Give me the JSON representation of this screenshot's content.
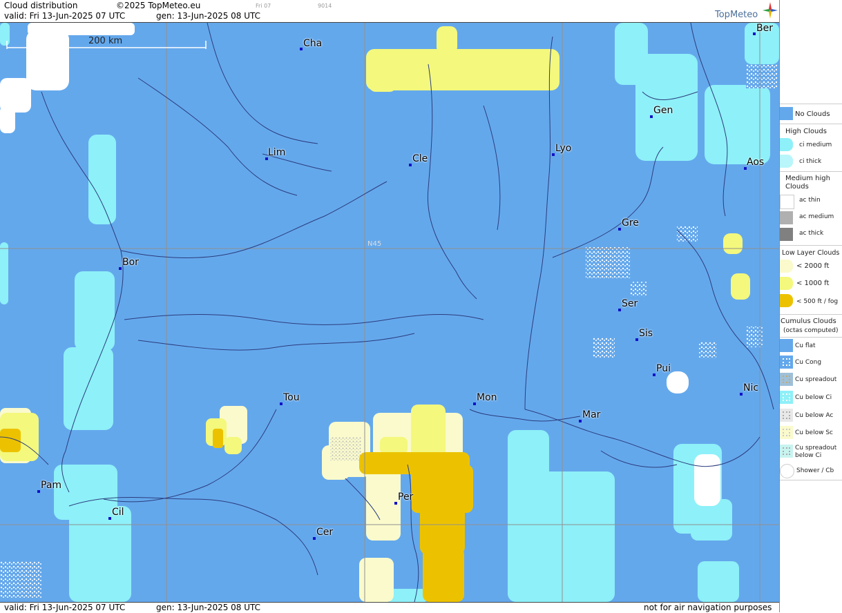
{
  "header": {
    "title": "Cloud distribution",
    "copyright": "©2025 TopMeteo.eu",
    "valid": "valid:  Fri  13-Jun-2025  07 UTC",
    "gen": "gen: 13-Jun-2025 08 UTC",
    "small_1": "Fri 07",
    "small_2": "9014",
    "brand": "TopMeteo"
  },
  "map": {
    "scale_label": "200 km",
    "lat_label": "N45",
    "cities": [
      "Ber",
      "Cha",
      "Gen",
      "Lim",
      "Cle",
      "Lyo",
      "Aos",
      "Gre",
      "Bor",
      "Ser",
      "Sis",
      "Pui",
      "Tou",
      "Mon",
      "Mar",
      "Nic",
      "Pam",
      "Cil",
      "Per",
      "Cer"
    ]
  },
  "footer": {
    "valid": "valid:  Fri  13-Jun-2025  07 UTC",
    "gen": "gen: 13-Jun-2025 08 UTC",
    "disclaimer": "not for air navigation purposes"
  },
  "legend": {
    "no_clouds": "No Clouds",
    "high_header": "High Clouds",
    "ci_medium": "ci medium",
    "ci_thick": "ci thick",
    "medium_header": "Medium high Clouds",
    "ac_thin": "ac thin",
    "ac_medium": "ac medium",
    "ac_thick": "ac thick",
    "low_header": "Low Layer Clouds",
    "low_2000": "< 2000 ft",
    "low_1000": "< 1000 ft",
    "low_500": "< 500 ft / fog",
    "cu_header": "Cumulus Clouds",
    "cu_sub": "(octas computed)",
    "cu_flat": "Cu flat",
    "cu_cong": "Cu Cong",
    "cu_spreadout": "Cu spreadout",
    "cu_below_ci": "Cu below Ci",
    "cu_below_ac": "Cu below Ac",
    "cu_below_sc": "Cu below Sc",
    "cu_spreadout_below_ci": "Cu spreadout below Ci",
    "shower": "Shower / Cb"
  },
  "colors": {
    "no_clouds": "#64a8ec",
    "ci": "#8ef0f8",
    "ac_thin": "#ffffff",
    "low_2000": "#fafacc",
    "low_1000": "#f4f87c",
    "low_500": "#ecc200",
    "grid": "#909090",
    "river": "#2a3c7c"
  }
}
